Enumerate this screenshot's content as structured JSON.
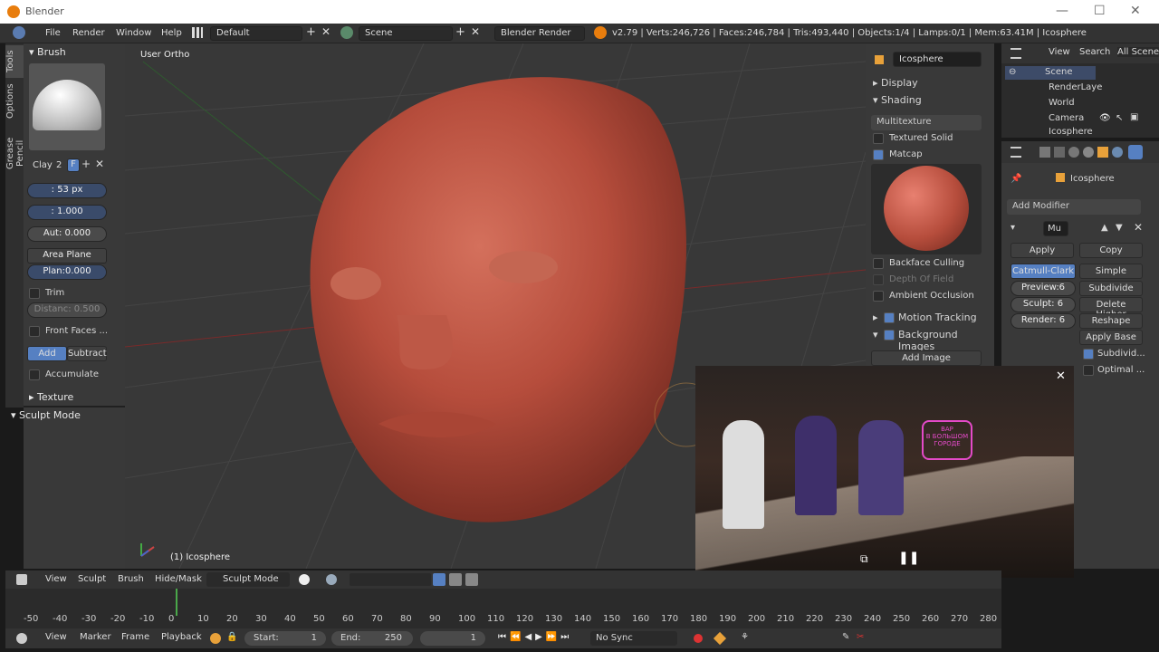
{
  "window": {
    "title": "Blender",
    "controls": [
      "—",
      "☐",
      "✕"
    ]
  },
  "infobar": {
    "menus": [
      "File",
      "Render",
      "Window",
      "Help"
    ],
    "layout": "Default",
    "scene": "Scene",
    "engine": "Blender Render",
    "stats": "v2.79 | Verts:246,726 | Faces:246,784 | Tris:493,440 | Objects:1/4 | Lamps:0/1 | Mem:63.41M | Icosphere"
  },
  "tooltabs": [
    "Tools",
    "Options",
    "Grease Pencil"
  ],
  "brush": {
    "header": "Brush",
    "name": "Clay",
    "users": "2",
    "fake_user": "F",
    "radius": ": 53 px",
    "strength": ": 1.000",
    "autosmooth": "Aut: 0.000",
    "plane": "Area Plane",
    "plane_offset": "Plan:0.000",
    "trim": "Trim",
    "distance": "Distanc: 0.500",
    "front_faces": "Front Faces ...",
    "add": "Add",
    "subtract": "Subtract",
    "accumulate": "Accumulate",
    "texture": "Texture",
    "sculpt_mode": "Sculpt Mode"
  },
  "viewport": {
    "view_label": "User Ortho",
    "object_label": "(1) Icosphere"
  },
  "npanel": {
    "object": "Icosphere",
    "display": "Display",
    "shading": "Shading",
    "shading_mode": "Multitexture",
    "textured_solid": "Textured Solid",
    "matcap": "Matcap",
    "backface": "Backface Culling",
    "dof": "Depth Of Field",
    "ao": "Ambient Occlusion",
    "motion_tracking": "Motion Tracking",
    "background_images": "Background Images",
    "add_image": "Add Image"
  },
  "outliner": {
    "tabs": [
      "View",
      "Search",
      "All Scene"
    ],
    "items": [
      "Scene",
      "RenderLaye",
      "World",
      "Camera",
      "Icosphere"
    ]
  },
  "properties": {
    "object": "Icosphere",
    "add_modifier": "Add Modifier",
    "mod_name": "Mu",
    "apply": "Apply",
    "copy": "Copy",
    "catmull": "Catmull-Clark",
    "simple": "Simple",
    "preview": "Preview:6",
    "subdivide": "Subdivide",
    "sculpt": "Sculpt:  6",
    "delete_higher": "Delete Higher",
    "render": "Render:  6",
    "reshape": "Reshape",
    "apply_base": "Apply Base",
    "subdivide_uvs": "Subdivid...",
    "optimal": "Optimal ..."
  },
  "vp_header": {
    "menus": [
      "View",
      "Sculpt",
      "Brush",
      "Hide/Mask"
    ],
    "mode": "Sculpt Mode"
  },
  "timeline": {
    "ticks": [
      "-50",
      "-40",
      "-30",
      "-20",
      "-10",
      "0",
      "10",
      "20",
      "30",
      "40",
      "50",
      "60",
      "70",
      "80",
      "90",
      "100",
      "110",
      "120",
      "130",
      "140",
      "150",
      "160",
      "170",
      "180",
      "190",
      "200",
      "210",
      "220",
      "230",
      "240",
      "250",
      "260",
      "270",
      "280"
    ]
  },
  "tl_header": {
    "menus": [
      "View",
      "Marker",
      "Frame",
      "Playback"
    ],
    "start": "Start:",
    "start_val": "1",
    "end": "End:",
    "end_val": "250",
    "current": "1",
    "sync": "No Sync"
  },
  "video": {
    "sign": "ВАР\nВ БОЛЬШОМ\nГОРОДЕ"
  },
  "colors": {
    "accent": "#5680c2",
    "head": "#b9503f",
    "bg": "#383838"
  }
}
